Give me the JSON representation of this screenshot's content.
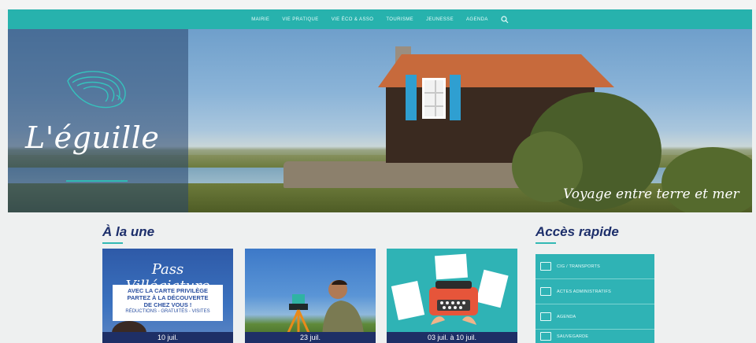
{
  "nav": {
    "items": [
      "Mairie",
      "Vie pratique",
      "Vie éco & asso",
      "Tourisme",
      "Jeunesse",
      "Agenda"
    ],
    "search_icon": "search-icon"
  },
  "hero": {
    "site_name": "L'éguille",
    "tagline": "Voyage entre terre et mer",
    "logo_icon": "oyster-icon"
  },
  "news": {
    "title": "À la une",
    "cards": [
      {
        "heading": "Pass Villégiature",
        "lines": [
          "Avec la carte privilège",
          "partez à la découverte",
          "de chez vous !"
        ],
        "sub": "Réductions - gratuités - visites",
        "footer": "10 juil."
      },
      {
        "footer": "23 juil."
      },
      {
        "footer": "03 juil. à 10 juil."
      }
    ]
  },
  "quick_access": {
    "title": "Accès rapide",
    "items": [
      {
        "label": "Cig / Transports",
        "icon": "id-card-icon"
      },
      {
        "label": "Actes administratifs",
        "icon": "document-icon"
      },
      {
        "label": "Agenda",
        "icon": "calendar-icon"
      },
      {
        "label": "Sauvegarde",
        "icon": "folder-icon"
      }
    ]
  },
  "colors": {
    "teal": "#27b2ad",
    "navy": "#1d2f6b"
  }
}
